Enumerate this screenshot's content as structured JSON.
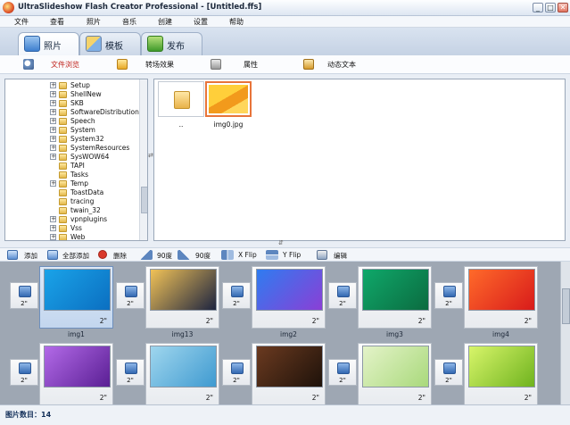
{
  "window": {
    "title": "UltraSlideshow Flash Creator Professional - [Untitled.ffs]",
    "controls": [
      "_",
      "□",
      "✕"
    ]
  },
  "menu": [
    "文件",
    "查看",
    "照片",
    "音乐",
    "创建",
    "设置",
    "帮助"
  ],
  "tabs": [
    {
      "label": "照片",
      "icon": "photo-icon"
    },
    {
      "label": "模板",
      "icon": "template-icon"
    },
    {
      "label": "发布",
      "icon": "publish-icon"
    }
  ],
  "subtabs": [
    {
      "label": "文件浏览",
      "icon": "magnifier-icon",
      "active": true
    },
    {
      "label": "转场效果",
      "icon": "transition-effect-icon"
    },
    {
      "label": "属性",
      "icon": "properties-icon"
    },
    {
      "label": "动态文本",
      "icon": "dynamic-text-icon"
    }
  ],
  "tree": {
    "items": [
      {
        "name": "Setup",
        "expand": true
      },
      {
        "name": "ShellNew",
        "expand": true
      },
      {
        "name": "SKB",
        "expand": true
      },
      {
        "name": "SoftwareDistribution",
        "expand": true
      },
      {
        "name": "Speech",
        "expand": true
      },
      {
        "name": "System",
        "expand": true
      },
      {
        "name": "System32",
        "expand": true
      },
      {
        "name": "SystemResources",
        "expand": true
      },
      {
        "name": "SysWOW64",
        "expand": true
      },
      {
        "name": "TAPI",
        "expand": false
      },
      {
        "name": "Tasks",
        "expand": false
      },
      {
        "name": "Temp",
        "expand": true
      },
      {
        "name": "ToastData",
        "expand": false
      },
      {
        "name": "tracing",
        "expand": false
      },
      {
        "name": "twain_32",
        "expand": false
      },
      {
        "name": "vpnplugins",
        "expand": true
      },
      {
        "name": "Vss",
        "expand": true
      },
      {
        "name": "Web",
        "expand": true
      }
    ]
  },
  "files": [
    {
      "label": "..",
      "kind": "folder"
    },
    {
      "label": "img0.jpg",
      "kind": "image",
      "selected": true
    }
  ],
  "toolbar": [
    {
      "label": "添加",
      "icon": "add-icon"
    },
    {
      "label": "全部添加",
      "icon": "add-all-icon"
    },
    {
      "label": "删除",
      "icon": "delete-icon"
    },
    {
      "label": "90度",
      "icon": "rotate-left-icon"
    },
    {
      "label": "90度",
      "icon": "rotate-right-icon"
    },
    {
      "label": "X Flip",
      "icon": "flip-x-icon"
    },
    {
      "label": "Y Flip",
      "icon": "flip-y-icon"
    },
    {
      "label": "编辑",
      "icon": "edit-icon"
    }
  ],
  "slides": [
    {
      "name": "img1",
      "duration": "2\"",
      "selected": true,
      "colors": [
        "#1aa3e8",
        "#0b6fc1"
      ]
    },
    {
      "name": "img13",
      "duration": "2\"",
      "selected": false,
      "colors": [
        "#f1c257",
        "#1d2440"
      ]
    },
    {
      "name": "img2",
      "duration": "2\"",
      "selected": false,
      "colors": [
        "#2f7cf0",
        "#8a3fd6"
      ]
    },
    {
      "name": "img3",
      "duration": "2\"",
      "selected": false,
      "colors": [
        "#0fa86a",
        "#0b6b40"
      ]
    },
    {
      "name": "img4",
      "duration": "2\"",
      "selected": false,
      "colors": [
        "#ff6a2a",
        "#d81b1b"
      ]
    },
    {
      "name": "",
      "duration": "2\"",
      "selected": false,
      "colors": [
        "#b36ae8",
        "#5a1f94"
      ]
    },
    {
      "name": "",
      "duration": "2\"",
      "selected": false,
      "colors": [
        "#9fd6ee",
        "#3f9ad0"
      ]
    },
    {
      "name": "",
      "duration": "2\"",
      "selected": false,
      "colors": [
        "#6b3a20",
        "#1e120a"
      ]
    },
    {
      "name": "",
      "duration": "2\"",
      "selected": false,
      "colors": [
        "#e4f3c9",
        "#a9d97b"
      ]
    },
    {
      "name": "",
      "duration": "2\"",
      "selected": false,
      "colors": [
        "#d8f56a",
        "#6fb31e"
      ]
    }
  ],
  "transition_duration": "2\"",
  "status": "图片数目：14"
}
